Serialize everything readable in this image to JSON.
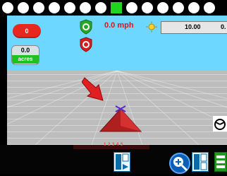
{
  "status": {
    "count": "0",
    "acres_value": "0.0",
    "acres_label": "acres",
    "speed": "0.0 mph",
    "field_value_1": "10.00",
    "field_value_2": "0."
  },
  "leds": {
    "count": 14,
    "active_index": 7,
    "active_color": "#1fd51f",
    "inactive_color": "#ffffff"
  },
  "lightbar": {
    "digits": "1 2 3 4 5",
    "color": "#ff3c2e"
  },
  "icons": {
    "gps_green": "shield-green-icon",
    "gps_red": "shield-red-icon",
    "sun": "sun-icon",
    "steering": "steering-wheel-icon",
    "arrow": "red-arrow-icon",
    "tractor": "tractor-position-icon",
    "zoom": "zoom-icon",
    "nav": "navigation-view-icon",
    "view": "screen-view-icon",
    "menu": "menu-icon"
  },
  "colors": {
    "sky": "#6ed7ff",
    "ground": "#bdbdbd",
    "alert": "#e8271f",
    "acres_green": "#1ec11e"
  }
}
